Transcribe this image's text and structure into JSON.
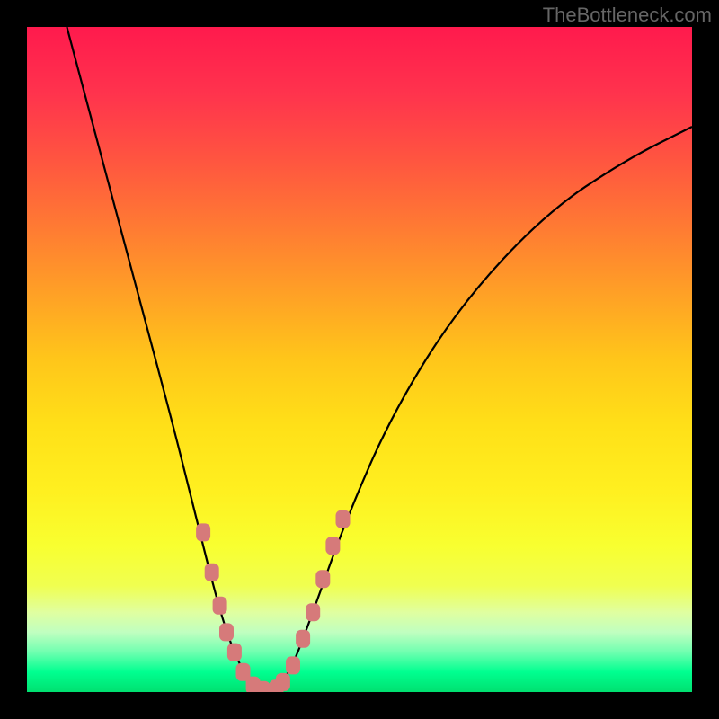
{
  "watermark": "TheBottleneck.com",
  "chart_data": {
    "type": "line",
    "title": "",
    "xlabel": "",
    "ylabel": "",
    "xlim": [
      0,
      100
    ],
    "ylim": [
      0,
      100
    ],
    "curve": {
      "name": "bottleneck-curve",
      "points": [
        {
          "x": 6,
          "y": 100
        },
        {
          "x": 10,
          "y": 85
        },
        {
          "x": 14,
          "y": 70
        },
        {
          "x": 18,
          "y": 55
        },
        {
          "x": 22,
          "y": 40
        },
        {
          "x": 25,
          "y": 28
        },
        {
          "x": 28,
          "y": 16
        },
        {
          "x": 30,
          "y": 9
        },
        {
          "x": 32,
          "y": 4
        },
        {
          "x": 34,
          "y": 1
        },
        {
          "x": 36,
          "y": 0
        },
        {
          "x": 38,
          "y": 1
        },
        {
          "x": 40,
          "y": 4
        },
        {
          "x": 43,
          "y": 12
        },
        {
          "x": 48,
          "y": 26
        },
        {
          "x": 55,
          "y": 42
        },
        {
          "x": 65,
          "y": 58
        },
        {
          "x": 78,
          "y": 72
        },
        {
          "x": 90,
          "y": 80
        },
        {
          "x": 100,
          "y": 85
        }
      ]
    },
    "markers": {
      "left": [
        {
          "x": 26.5,
          "y": 24
        },
        {
          "x": 27.8,
          "y": 18
        },
        {
          "x": 29.0,
          "y": 13
        },
        {
          "x": 30.0,
          "y": 9
        },
        {
          "x": 31.2,
          "y": 6
        },
        {
          "x": 32.5,
          "y": 3
        },
        {
          "x": 34.0,
          "y": 1
        },
        {
          "x": 35.5,
          "y": 0.3
        }
      ],
      "right": [
        {
          "x": 37.5,
          "y": 0.5
        },
        {
          "x": 38.5,
          "y": 1.5
        },
        {
          "x": 40.0,
          "y": 4
        },
        {
          "x": 41.5,
          "y": 8
        },
        {
          "x": 43.0,
          "y": 12
        },
        {
          "x": 44.5,
          "y": 17
        },
        {
          "x": 46.0,
          "y": 22
        },
        {
          "x": 47.5,
          "y": 26
        }
      ]
    },
    "marker_color": "#d67a7a",
    "curve_color": "#000000"
  }
}
